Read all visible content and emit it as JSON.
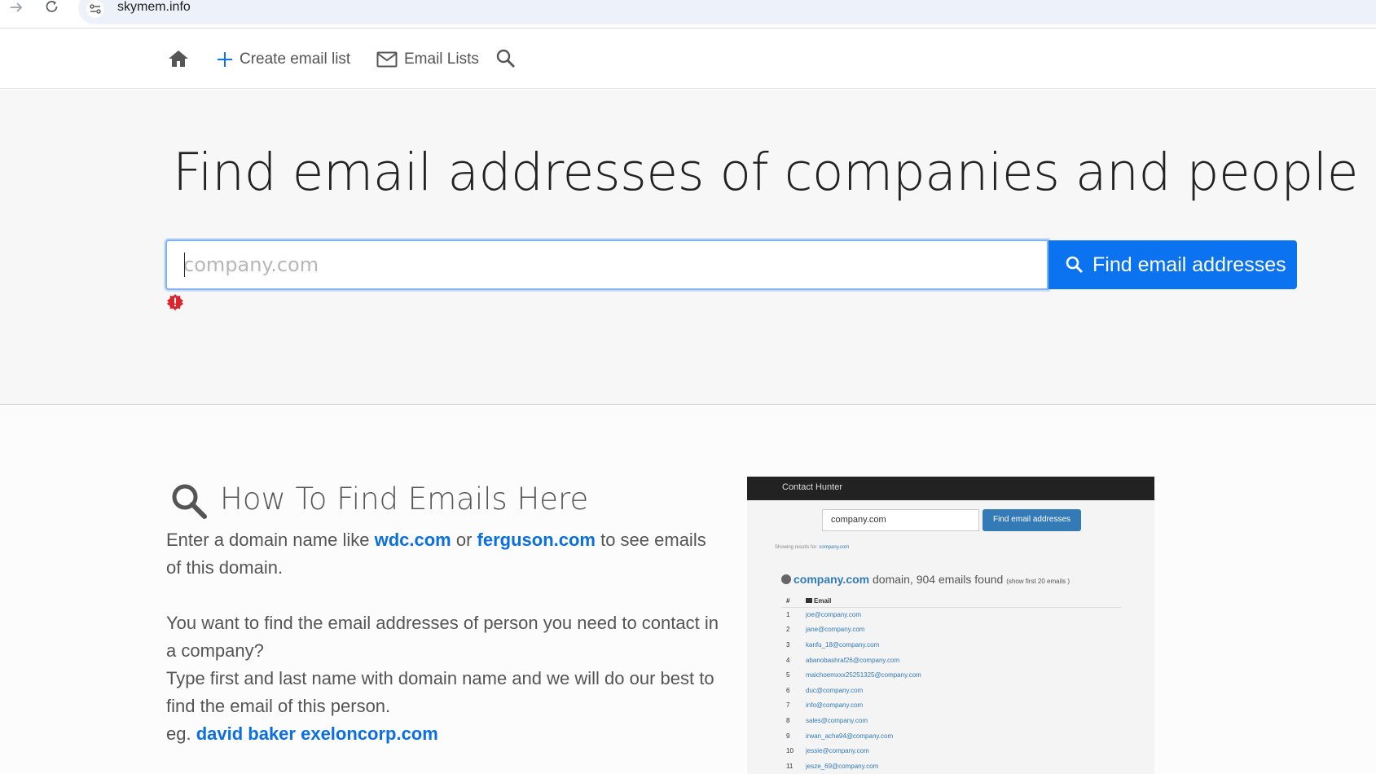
{
  "browser": {
    "url": "skymem.info"
  },
  "nav": {
    "create_label": "Create email list",
    "lists_label": "Email Lists"
  },
  "hero": {
    "title": "Find email addresses of companies and people",
    "search_placeholder": "company.com",
    "search_value": "",
    "button_label": "Find email addresses"
  },
  "how": {
    "title": "How To Find Emails Here",
    "intro_1": "Enter a domain name like ",
    "example_1": "wdc.com",
    "intro_or": " or ",
    "example_2": "ferguson.com",
    "intro_2": " to see emails of this domain.",
    "para_2": "You want to find the email addresses of person you need to contact in a company?",
    "para_3": "Type first and last name with domain name and we will do our best to find the email of this person.",
    "eg_prefix": "eg. ",
    "eg_link": "david baker exeloncorp.com"
  },
  "preview": {
    "header": "Contact Hunter",
    "input_value": "company.com",
    "button_label": "Find email addresses",
    "showing_prefix": "Showing results for: ",
    "showing_domain": "company.com",
    "domain": "company.com",
    "domain_text": " domain, 904 emails found ",
    "show_first": "(show first 20 emails )",
    "col_num": "#",
    "col_email": "Email",
    "rows": [
      {
        "n": "1",
        "email": "joe@company.com"
      },
      {
        "n": "2",
        "email": "jane@company.com"
      },
      {
        "n": "3",
        "email": "kanfu_18@company.com"
      },
      {
        "n": "4",
        "email": "abanobashraf26@company.com"
      },
      {
        "n": "5",
        "email": "maichoemxxx25251325@company.com"
      },
      {
        "n": "6",
        "email": "duc@company.com"
      },
      {
        "n": "7",
        "email": "info@company.com"
      },
      {
        "n": "8",
        "email": "sales@company.com"
      },
      {
        "n": "9",
        "email": "irwan_acha94@company.com"
      },
      {
        "n": "10",
        "email": "jessie@company.com"
      },
      {
        "n": "11",
        "email": "jesze_69@company.com"
      }
    ]
  },
  "colors": {
    "accent": "#0b73f0",
    "link": "#0b6fe0",
    "error": "#d9252b"
  },
  "icons": [
    "forward-icon",
    "reload-icon",
    "site-settings-icon",
    "home-icon",
    "plus-icon",
    "mail-icon",
    "search-icon",
    "error-icon"
  ]
}
